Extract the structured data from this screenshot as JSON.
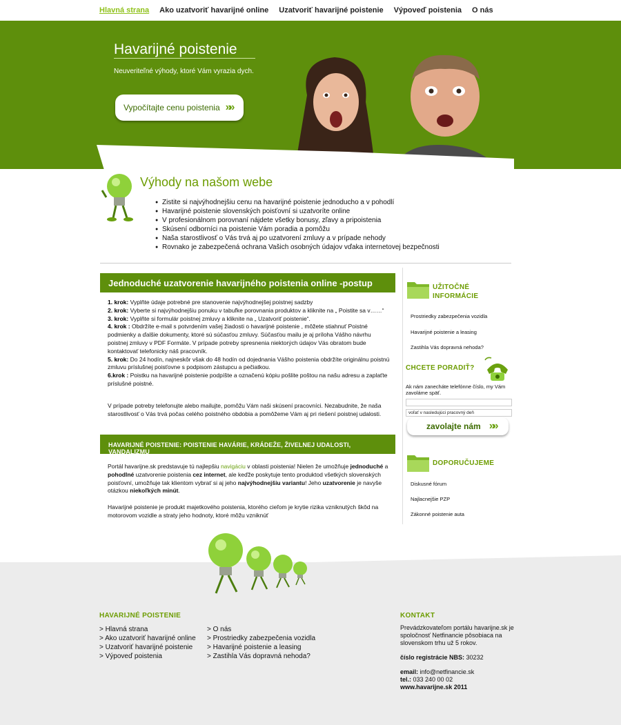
{
  "nav": {
    "items": [
      {
        "label": "Hlavná strana",
        "active": true
      },
      {
        "label": "Ako uzatvoriť havarijné online",
        "active": false
      },
      {
        "label": "Uzatvoriť havarijné poistenie",
        "active": false
      },
      {
        "label": "Výpoveď poistenia",
        "active": false
      },
      {
        "label": "O nás",
        "active": false
      }
    ]
  },
  "hero": {
    "title": "Havarijné poistenie",
    "subtitle": "Neuveriteľné výhody, ktoré Vám vyrazia dych.",
    "button_label": "Vypočítajte cenu poistenia",
    "button_arrow": "»»"
  },
  "advantages": {
    "title": "Výhody na našom webe",
    "items": [
      "Zistite si najvýhodnejšiu cenu na havarijné poistenie jednoducho a v pohodlí",
      "Havarijné poistenie slovenských poisťovní si uzatvoríte online",
      "V profesionálnom porovnaní nájdete všetky bonusy, zľavy a pripoistenia",
      "Skúsení odborníci na poistenie Vám poradia a pomôžu",
      "Naša starostlivosť o Vás trvá aj po uzatvorení zmluvy a v prípade nehody",
      "Rovnako je zabezpečená ochrana Vašich osobných údajov vďaka internetovej bezpečnosti"
    ]
  },
  "main": {
    "box1_title": "Jednoduché uzatvorenie havarijného poistenia online -postup",
    "steps": [
      {
        "label": "1. krok:",
        "text": " Vyplňte údaje potrebné pre stanovenie najvýhodnejšej poistnej sadzby"
      },
      {
        "label": "2. krok:",
        "text": " Vyberte si najvýhodnejšiu ponuku v tabuľke porovnania produktov a kliknite na „ Poistite sa v……“"
      },
      {
        "label": "3. krok:",
        "text": " Vyplňte si formulár poistnej zmluvy a kliknite na „ Uzatvoriť poistenie“."
      },
      {
        "label": "4. krok :",
        "text": " Obdržíte e-mail s potvrdením vašej žiadosti o havarijné poistenie , môžete stiahnuť Poistné podmienky a ďalšie dokumenty, ktoré sú súčasťou zmluvy. Súčasťou mailu je aj príloha Vášho návrhu poistnej zmluvy v PDF Formáte. V prípade potreby spresnenia niektorých údajov Vás obratom bude kontaktovať telefonicky náš pracovník."
      },
      {
        "label": "5. krok:",
        "text": " Do 24 hodín, najneskôr však do 48 hodín od dojednania Vášho poistenia obdržíte originálnu poistnú zmluvu príslušnej poisťovne s podpisom zástupcu a pečiatkou."
      },
      {
        "label": "6.krok :",
        "text": " Poistku na havarijné poistenie podpíšte a označenú kópiu pošlite poštou na našu adresu a zaplaťte príslušné poistné."
      }
    ],
    "contact_para": "V prípade potreby telefonujte alebo mailujte, pomôžu Vám naši skúsení pracovníci. Nezabudnite, že naša starostlivosť o Vás trvá počas celého poistného obdobia a pomôžeme Vám aj pri riešení poistnej udalosti.",
    "box2_title": "Havarijné poistenie: poistenie havárie, krádeže, živelnej udalosti, vandalizmu",
    "p1_a": "Portál havarijne.sk predstavuje tú najlepšiu ",
    "p1_link": "navigáciu",
    "p1_b": " v oblasti poistenia! Nielen že umožňuje ",
    "p1_bold1": "jednoduché",
    "p1_c": " a ",
    "p1_bold2": "pohodlné",
    "p1_d": " uzatvorenie poistenia ",
    "p1_bold3": "cez internet",
    "p1_e": ", ale keďže poskytuje tento produktod všetkých slovenských poisťovní, umožňuje tak klientom vybrať si aj jeho ",
    "p1_bold4": "najvýhodnejšiu variantu",
    "p1_f": "! Jeho ",
    "p1_bold5": "uzatvorenie",
    "p1_g": " je navyše otázkou ",
    "p1_bold6": "niekoľkých minút",
    "p1_h": ".",
    "p2": "Havarijné poistenie je produkt majetkového poistenia, ktorého cieľom je krytie rizika vzniknutých škôd na motorovom vozidle a straty jeho hodnoty, ktoré môžu vzniknúť"
  },
  "sidebar": {
    "useful_title": "Užitočné informácie",
    "useful_links": [
      "Prostriedky zabezpečenia vozidla",
      "Havarijné poistenie a leasing",
      "Zastihla Vás dopravná nehoda?"
    ],
    "advise_title": "Chcete poradiť?",
    "advise_text": "Ak nám zanecháte telefónne číslo, my Vám zavoláme späť.",
    "phone_input_value": "",
    "select_value": "voľať v nasledujúci pracovný deň",
    "call_button_label": "zavolajte nám",
    "call_button_arrow": "»»",
    "recommend_title": "Doporučujeme",
    "recommend_links": [
      "Diskusné fórum",
      "Najlacnejšie PZP",
      "Zákonné poistenie auta"
    ]
  },
  "footer": {
    "col1_title": "Havarijné poistenie",
    "col1_links": [
      "> Hlavná strana",
      "> Ako uzatvoriť havarijné online",
      "> Uzatvoriť havarijné poistenie",
      "> Výpoveď poistenia"
    ],
    "col2_links": [
      "> O nás",
      "> Prostriedky zabezpečenia vozidla",
      "> Havarijné poistenie a leasing",
      "> Zastihla Vás dopravná nehoda?"
    ],
    "contact_title": "Kontakt",
    "contact_text": "Prevádzkovateľom portálu havarijne.sk je spoločnosť Netfinancie pôsobiaca na slovenskom trhu už 5 rokov.",
    "reg_label": "číslo registrácie NBS:",
    "reg_value": " 30232",
    "email_label": "email:",
    "email_value": " info@netfinancie.sk",
    "tel_label": "tel.:",
    "tel_value": " 033 240 00 02",
    "copyright": "www.havarijne.sk 2011"
  },
  "colors": {
    "brand_green": "#5e8f0c",
    "heading_green": "#6c9c00",
    "footer_bg": "#ececec"
  }
}
